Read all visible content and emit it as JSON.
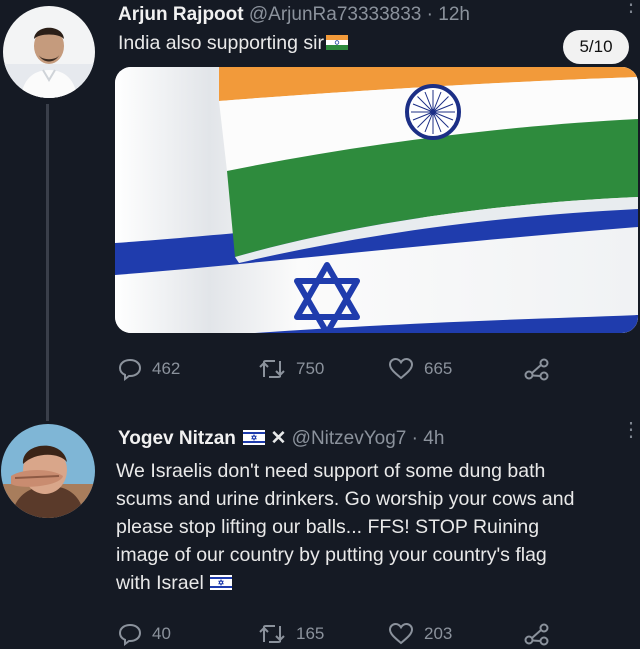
{
  "tweets": [
    {
      "author": "Arjun Rajpoot",
      "handle": "@ArjunRa73333833",
      "time": "· 12h",
      "text": "India also supporting sir",
      "media_counter": "5/10",
      "replies": "462",
      "retweets": "750",
      "likes": "665"
    },
    {
      "author": "Yogev Nitzan",
      "handle": "@NitzevYog7",
      "time": "· 4h",
      "text_lines": [
        "We Israelis don't need support of some dung bath",
        "scums and urine drinkers. Go worship your cows and",
        "please stop lifting our balls... FFS! STOP Ruining",
        "image of our country by putting your country's flag",
        "with Israel"
      ],
      "replies": "40",
      "retweets": "165",
      "likes": "203"
    }
  ],
  "colors": {
    "background": "#151a24",
    "muted": "#8b929c",
    "text": "#e9e9e9"
  },
  "icons": [
    "reply-icon",
    "retweet-icon",
    "like-icon",
    "share-icon",
    "more-icon",
    "india-flag-icon",
    "israel-flag-icon",
    "x-emoji-icon"
  ]
}
